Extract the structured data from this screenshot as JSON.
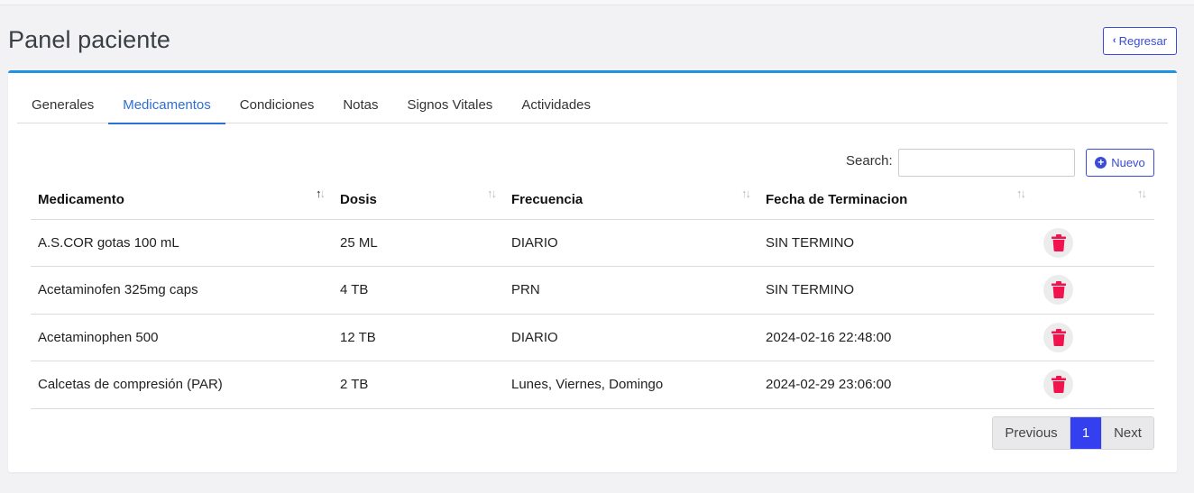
{
  "page": {
    "title": "Panel paciente",
    "back_label": "Regresar"
  },
  "tabs": [
    {
      "label": "Generales",
      "active": false
    },
    {
      "label": "Medicamentos",
      "active": true
    },
    {
      "label": "Condiciones",
      "active": false
    },
    {
      "label": "Notas",
      "active": false
    },
    {
      "label": "Signos Vitales",
      "active": false
    },
    {
      "label": "Actividades",
      "active": false
    }
  ],
  "toolbar": {
    "search_label": "Search:",
    "search_value": "",
    "new_label": "Nuevo"
  },
  "table": {
    "columns": [
      "Medicamento",
      "Dosis",
      "Frecuencia",
      "Fecha de Terminacion",
      ""
    ],
    "sorted_column": "Medicamento",
    "sort_direction": "ascending",
    "rows": [
      {
        "medicamento": "A.S.COR gotas 100 mL",
        "dosis": "25 ML",
        "frecuencia": "DIARIO",
        "fecha": "SIN TERMINO"
      },
      {
        "medicamento": "Acetaminofen 325mg caps",
        "dosis": "4 TB",
        "frecuencia": "PRN",
        "fecha": "SIN TERMINO"
      },
      {
        "medicamento": "Acetaminophen 500",
        "dosis": "12 TB",
        "frecuencia": "DIARIO",
        "fecha": "2024-02-16 22:48:00"
      },
      {
        "medicamento": "Calcetas de compresión (PAR)",
        "dosis": "2 TB",
        "frecuencia": "Lunes, Viernes, Domingo",
        "fecha": "2024-02-29 23:06:00"
      }
    ]
  },
  "pagination": {
    "previous_label": "Previous",
    "current_page": "1",
    "next_label": "Next"
  },
  "icons": {
    "back": "chevron-left-icon",
    "new": "plus-circle-icon",
    "delete": "trash-icon",
    "sort": "sort-arrows-icon"
  },
  "colors": {
    "accent_blue": "#3b4ad8",
    "tab_active": "#2e6fd6",
    "card_border_top": "#1e93e6",
    "delete_red": "#f0134d",
    "page_active": "#3440f0"
  }
}
